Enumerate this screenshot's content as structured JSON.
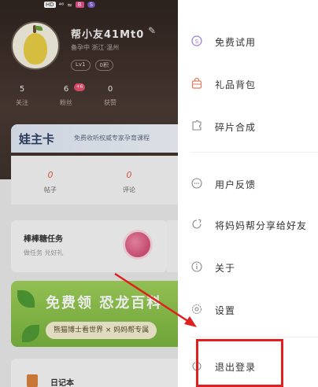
{
  "status_bar": {
    "hd": "HD",
    "sig1": "⁴⁶",
    "wifi": "≈",
    "badge_pink": "B",
    "badge_purple": "S"
  },
  "profile": {
    "name": "帮小友41Mt0",
    "subtitle": "备孕中  浙江·温州",
    "level": "Lv1",
    "points": "0积",
    "stats": [
      {
        "value": "5",
        "label": "关注"
      },
      {
        "value": "6",
        "label": "粉丝"
      },
      {
        "value": "0",
        "label": "获赞"
      }
    ],
    "fans_badge": "+6"
  },
  "vip": {
    "logo": "娃主卡",
    "text": "免费收听权威专家孕育课程"
  },
  "counts": [
    {
      "value": "0",
      "label": "帖子"
    },
    {
      "value": "0",
      "label": "评论"
    }
  ],
  "task": {
    "title": "棒棒糖任务",
    "subtitle": "做任务 兑好礼"
  },
  "banner": {
    "headline": "免费领 恐龙百科",
    "sub": "熊猫博士看世界 × 妈妈帮专属"
  },
  "diary": {
    "title": "日记本"
  },
  "menu": {
    "items": [
      {
        "id": "free-trial",
        "label": "免费试用",
        "icon": "coin-icon"
      },
      {
        "id": "gift-bag",
        "label": "礼品背包",
        "icon": "bag-icon"
      },
      {
        "id": "fragment-merge",
        "label": "碎片合成",
        "icon": "puzzle-icon"
      },
      {
        "id": "feedback",
        "label": "用户反馈",
        "icon": "chat-icon"
      },
      {
        "id": "share",
        "label": "将妈妈帮分享给好友",
        "icon": "share-icon"
      },
      {
        "id": "about",
        "label": "关于",
        "icon": "info-icon"
      },
      {
        "id": "settings",
        "label": "设置",
        "icon": "gear-icon"
      },
      {
        "id": "logout",
        "label": "退出登录",
        "icon": "logout-icon"
      }
    ]
  },
  "colors": {
    "highlight": "#e01f1f",
    "accent_orange": "#e05a3c",
    "drawer_bg": "#ffffff"
  }
}
